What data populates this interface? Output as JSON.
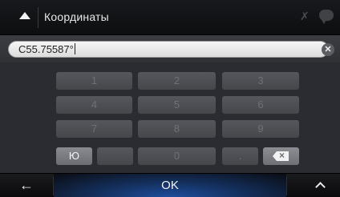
{
  "header": {
    "title": "Координаты",
    "back_icon": "triangle-up-icon"
  },
  "input": {
    "value": "C55.75587°",
    "clear_icon": "clear-circle-icon",
    "clear_glyph": "✕"
  },
  "keypad": {
    "rows": [
      [
        "1",
        "2",
        "3"
      ],
      [
        "4",
        "5",
        "6"
      ],
      [
        "7",
        "8",
        "9"
      ]
    ],
    "bottom_row": {
      "toggle": "Ю",
      "left_blank": "",
      "zero": "0",
      "dot": ".",
      "delete_icon": "backspace-icon"
    }
  },
  "footer": {
    "back_glyph": "←",
    "ok_label": "OK",
    "up_icon": "chevron-up-icon"
  }
}
